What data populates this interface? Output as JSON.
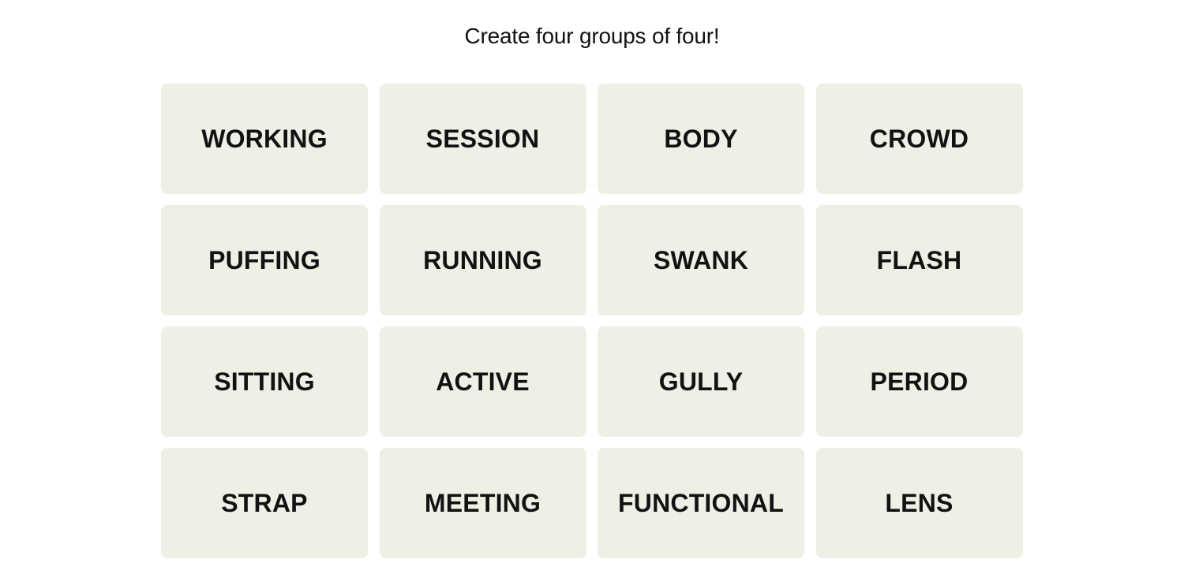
{
  "header": {
    "instructions": "Create four groups of four!"
  },
  "board": {
    "tiles": [
      {
        "label": "WORKING"
      },
      {
        "label": "SESSION"
      },
      {
        "label": "BODY"
      },
      {
        "label": "CROWD"
      },
      {
        "label": "PUFFING"
      },
      {
        "label": "RUNNING"
      },
      {
        "label": "SWANK"
      },
      {
        "label": "FLASH"
      },
      {
        "label": "SITTING"
      },
      {
        "label": "ACTIVE"
      },
      {
        "label": "GULLY"
      },
      {
        "label": "PERIOD"
      },
      {
        "label": "STRAP"
      },
      {
        "label": "MEETING"
      },
      {
        "label": "FUNCTIONAL"
      },
      {
        "label": "LENS"
      }
    ]
  },
  "colors": {
    "tile_background": "#efefe6",
    "text": "#121212",
    "page_background": "#ffffff"
  }
}
